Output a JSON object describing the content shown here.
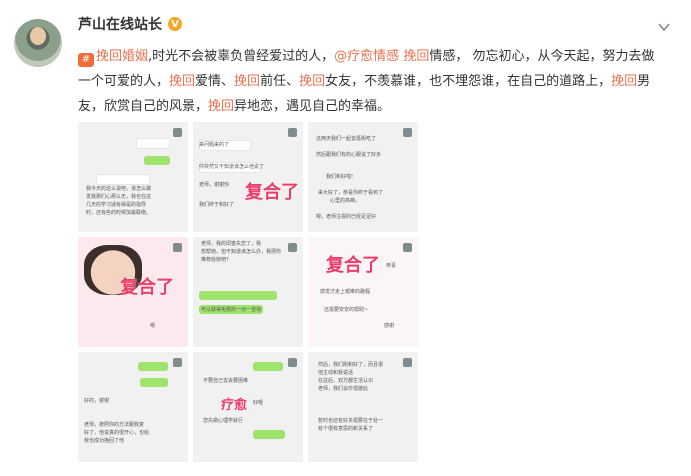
{
  "header": {
    "username": "芦山在线站长",
    "verified_badge": "V"
  },
  "post": {
    "icon": "tag-icon",
    "segments": [
      {
        "text": "挽回婚姻",
        "type": "link"
      },
      {
        "text": ",时光不会被辜负曾经爱过的人，",
        "type": "text"
      },
      {
        "text": "@疗愈情感",
        "type": "mention"
      },
      {
        "text": " ",
        "type": "text"
      },
      {
        "text": "挽回",
        "type": "link"
      },
      {
        "text": "情感， 勿忘初心，从今天起，努力去做一个可爱的人，",
        "type": "text"
      },
      {
        "text": "挽回",
        "type": "link"
      },
      {
        "text": "爱情、",
        "type": "text"
      },
      {
        "text": "挽回",
        "type": "link"
      },
      {
        "text": "前任、",
        "type": "text"
      },
      {
        "text": "挽回",
        "type": "link"
      },
      {
        "text": "女友，不羡慕谁，也不埋怨谁，在自己的道路上，",
        "type": "text"
      },
      {
        "text": "挽回",
        "type": "link"
      },
      {
        "text": "男友，欣赏自己的风景，",
        "type": "text"
      },
      {
        "text": "挽回",
        "type": "link"
      },
      {
        "text": "异地恋，遇见自己的幸福。",
        "type": "text"
      }
    ]
  },
  "images": {
    "t1": {
      "lines": [
        "我今天的这么说吧，该怎么做",
        "发我那们心那么无，我也在这",
        "几天的学习适有缘是的指导",
        "时，还有些的时候加最联络。"
      ]
    },
    "t2": {
      "lines": [
        "来问题来的了",
        "你突然又不知道该怎么他说了",
        "老师，谢谢你",
        "我们终于和好了"
      ],
      "stamp": "复合了"
    },
    "t3": {
      "lines": [
        "这两天我们一起去逛街吃了",
        "然后跟我们有的心跟说了好多",
        "我们和好啦!",
        "来大好了，恭喜你终于看到了",
        "心里的高峰。",
        "嗯，老师注视的已经足足好"
      ]
    },
    "t4": {
      "stamp": "复合了",
      "lines": [
        "嗯"
      ]
    },
    "t5": {
      "lines": [
        "老师，我的闺蜜失恋了，我",
        "想帮她，但不知道该怎么办，我把你",
        "推荐给她吧?",
        "可以获得免费的一对一咨询"
      ]
    },
    "t6": {
      "stamp": "复合了",
      "lines": [
        "恭喜",
        "感觉才走上艰难的路程",
        "还需要安安的帮助~",
        "感谢"
      ]
    },
    "t7": {
      "lines": [
        "好的，谢谢",
        "老师，按照你的方法跟我复",
        "好了，他说真的很开心，也给",
        "我也成功挽回了他"
      ]
    },
    "t8": {
      "stamp": "疗愈",
      "lines": [
        "不要自己去会要困难",
        "好喔",
        "您先做心理学就行"
      ]
    },
    "t9": {
      "lines": [
        "然后，我们刚和好了，而且很",
        "他主动和我说话",
        "在这后，双方都生活认识",
        "老师，我们会珍惜彼此",
        "暂时也还有好多需要在于处一",
        "有个很有意思的新关系了"
      ]
    }
  }
}
